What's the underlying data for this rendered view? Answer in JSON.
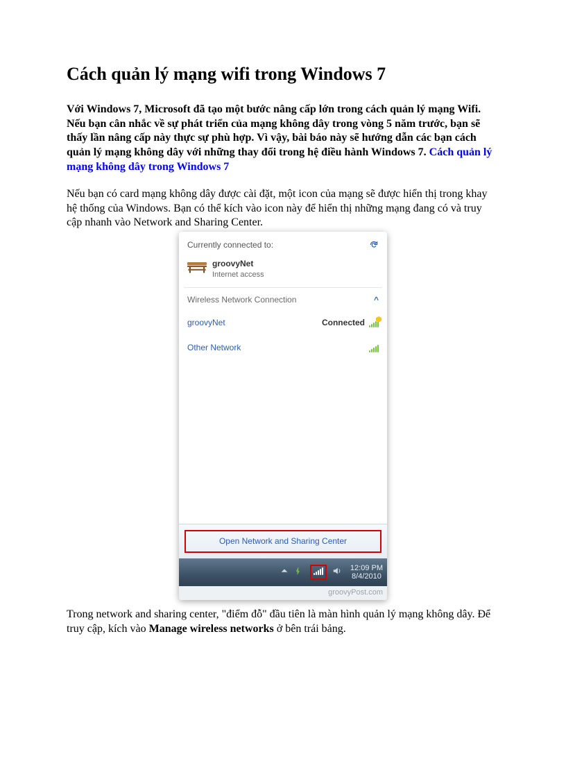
{
  "title": "Cách quản lý mạng wifi trong Windows 7",
  "intro": "Với Windows 7, Microsoft đã tạo một bước nâng cấp lớn trong cách quản lý mạng Wifi. Nếu bạn cân nhắc về sự phát triển của mạng không dây trong vòng 5 năm trước, bạn sẽ thấy lần nâng cấp này thực sự phù hợp. Vì vậy, bài báo này sẽ hướng dẫn các bạn cách quản lý mạng không dây với những thay đổi trong hệ điều hành Windows 7. ",
  "intro_link": "Cách quản lý mạng không dây trong Windows 7",
  "para1": "Nếu bạn có card mạng không dây được cài đặt, một icon của mạng sẽ được hiển thị trong khay hệ thống của Windows. Bạn có thể kích vào icon này để hiển thị những mạng đang có và truy cập nhanh vào Network and Sharing Center.",
  "flyout": {
    "currently": "Currently connected to:",
    "net_name": "groovyNet",
    "net_sub": "Internet access",
    "section": "Wireless Network Connection",
    "rows": [
      {
        "name": "groovyNet",
        "status": "Connected",
        "shield": true
      },
      {
        "name": "Other Network",
        "status": "",
        "shield": false
      }
    ],
    "footer_link": "Open Network and Sharing Center"
  },
  "taskbar": {
    "time": "12:09 PM",
    "date": "8/4/2010"
  },
  "watermark": "groovyPost.com",
  "para2_a": "Trong network and sharing center, \"điểm đỗ\" đầu tiên là màn hình quản lý mạng không dây. Để truy cập, kích vào ",
  "para2_bold": "Manage wireless networks",
  "para2_b": " ở bên trái bảng."
}
